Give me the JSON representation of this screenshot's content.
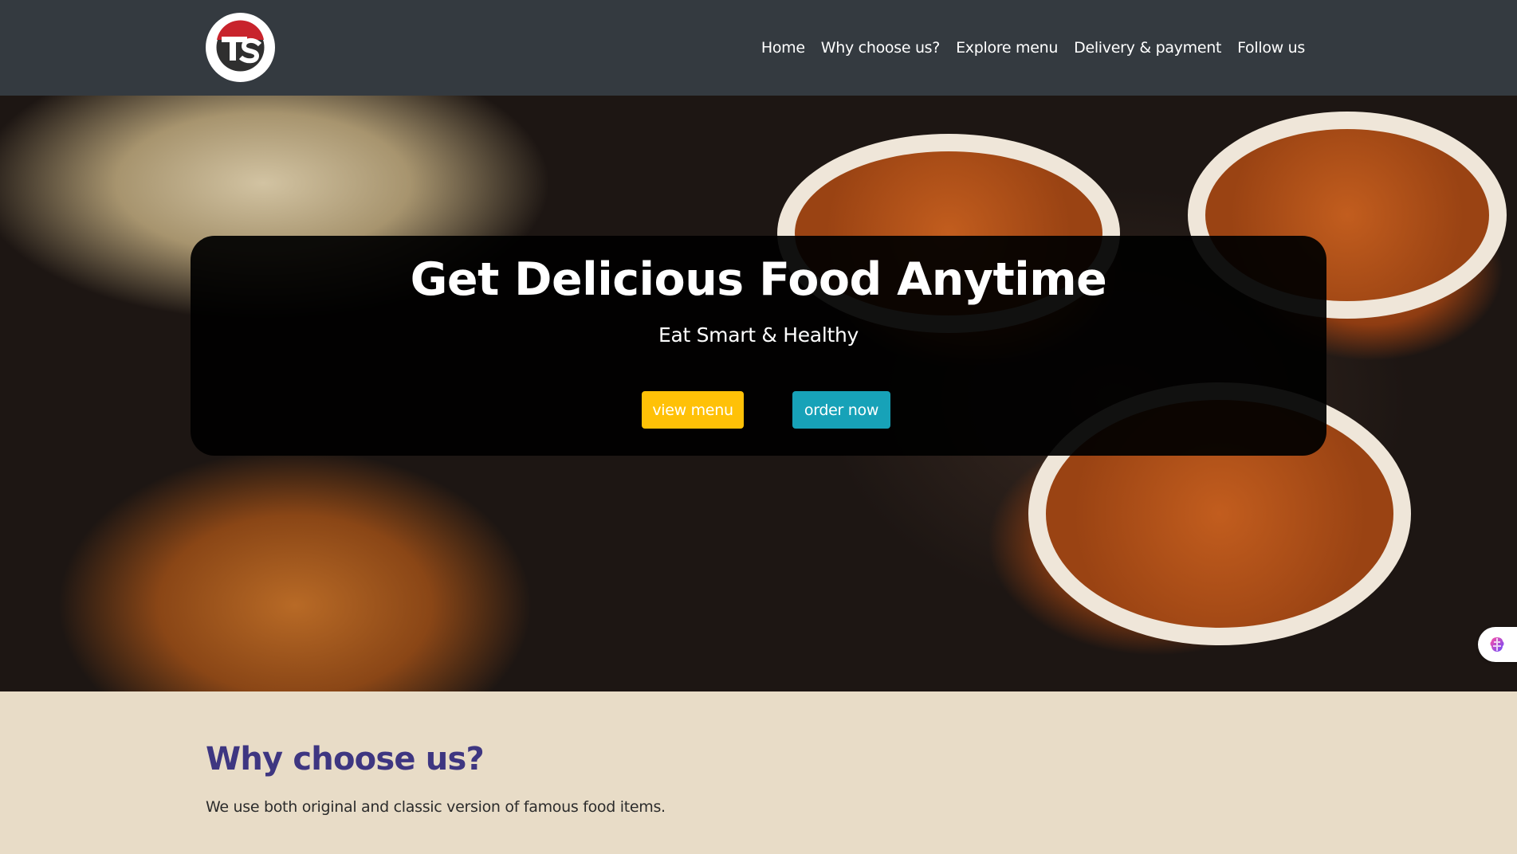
{
  "navbar": {
    "logo_icon": "ts-logo-icon",
    "links": [
      "Home",
      "Why choose us?",
      "Explore menu",
      "Delivery & payment",
      "Follow us"
    ]
  },
  "hero": {
    "title": "Get Delicious Food Anytime",
    "subtitle": "Eat Smart & Healthy",
    "view_menu_label": "view menu",
    "order_now_label": "order now",
    "colors": {
      "view_menu": "#ffc107",
      "order_now": "#17a2b8"
    }
  },
  "why": {
    "title": "Why choose us?",
    "text": "We use both original and classic version of famous food items."
  },
  "colors": {
    "navbar": "#343a40",
    "section_bg": "#e8dcc7",
    "heading": "#3e3681"
  },
  "widget": {
    "icon": "brain-icon"
  }
}
